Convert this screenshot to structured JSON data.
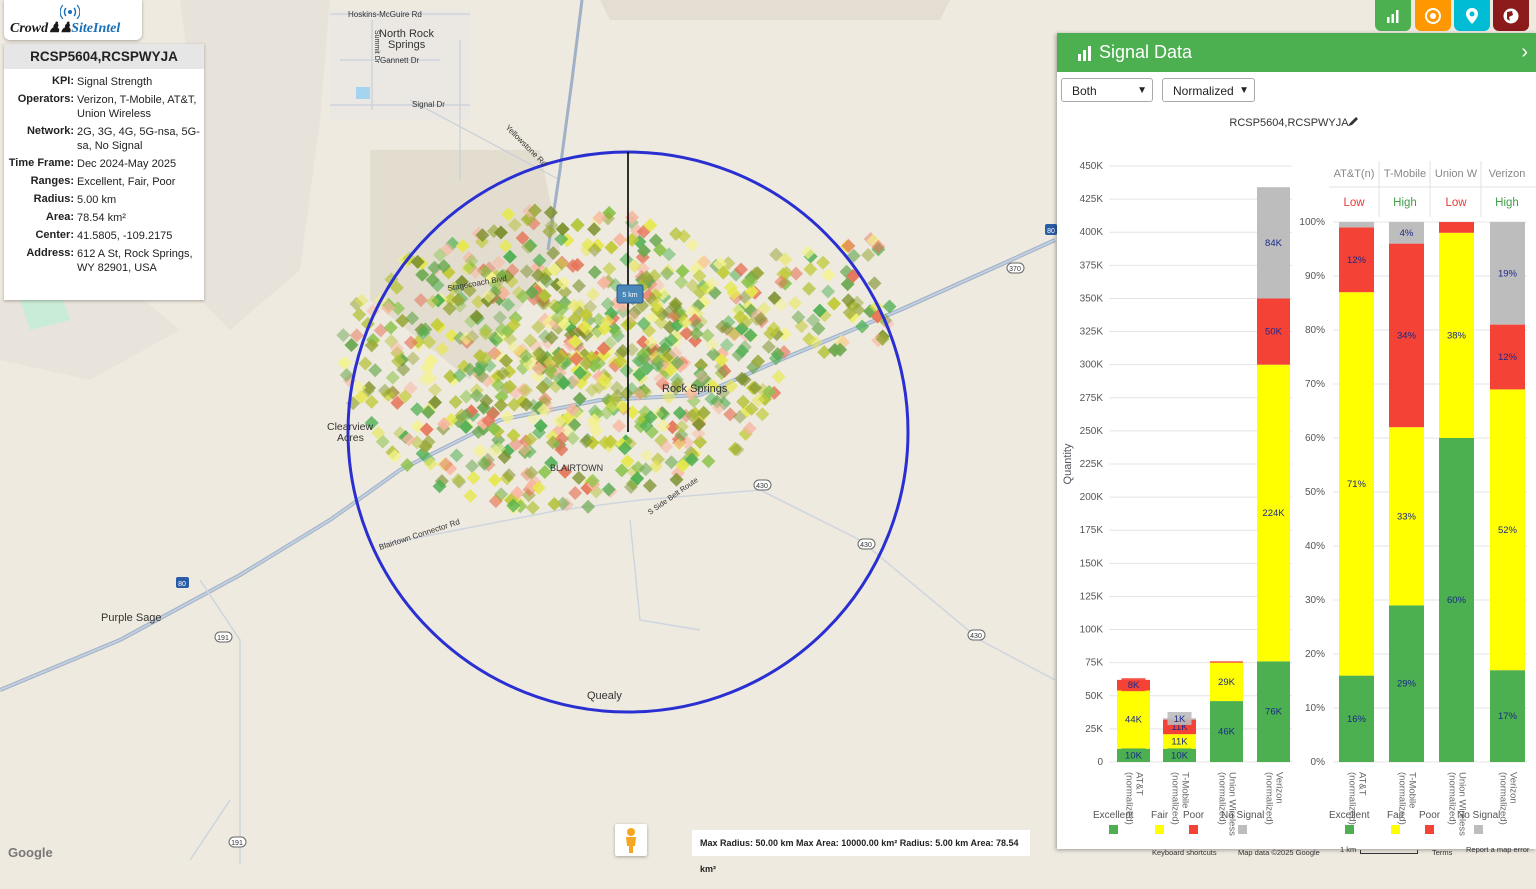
{
  "logo": {
    "part1": "Crowd",
    "part2": "SiteIntel"
  },
  "info": {
    "title": "RCSP5604,RCSPWYJA",
    "rows": [
      {
        "k": "KPI:",
        "v": "Signal Strength"
      },
      {
        "k": "Operators:",
        "v": "Verizon, T-Mobile, AT&T, Union Wireless"
      },
      {
        "k": "Network:",
        "v": "2G, 3G, 4G, 5G-nsa, 5G-sa, No Signal"
      },
      {
        "k": "Time Frame:",
        "v": "Dec 2024-May 2025"
      },
      {
        "k": "Ranges:",
        "v": "Excellent, Fair, Poor"
      },
      {
        "k": "Radius:",
        "v": "5.00 km"
      },
      {
        "k": "Area:",
        "v": "78.54 km²"
      },
      {
        "k": "Center:",
        "v": "41.5805, -109.2175"
      },
      {
        "k": "Address:",
        "v": "612 A St, Rock Springs, WY 82901, USA"
      }
    ]
  },
  "toolbar": {
    "icons": [
      {
        "name": "bar-chart-icon",
        "color": "#4caf50"
      },
      {
        "name": "target-icon",
        "color": "#ff9800"
      },
      {
        "name": "map-pin-icon",
        "color": "#00bcd4"
      },
      {
        "name": "globe-icon",
        "color": "#8b1a1a"
      }
    ]
  },
  "map": {
    "labels": [
      {
        "t": "Hoskins-McGuire Rd"
      },
      {
        "t": "North Rock"
      },
      {
        "t": "Springs"
      },
      {
        "t": "Gannett Dr"
      },
      {
        "t": "Signal Dr"
      },
      {
        "t": "Yellowstone Rd"
      },
      {
        "t": "Summit Dr"
      },
      {
        "t": "Rock Springs"
      },
      {
        "t": "Clearview"
      },
      {
        "t": "Acres"
      },
      {
        "t": "BLAIRTOWN"
      },
      {
        "t": "Blairtown Connector Rd"
      },
      {
        "t": "Purple Sage"
      },
      {
        "t": "Quealy"
      },
      {
        "t": "S Side Belt Route"
      },
      {
        "t": "Stagecoach Blvd"
      }
    ],
    "radius_label": "5 km",
    "shields": [
      "370",
      "430",
      "430",
      "430",
      "191",
      "191",
      "80",
      "80"
    ]
  },
  "panel": {
    "title": "Signal Data",
    "select1": "Both",
    "select2": "Normalized",
    "chart_title": "RCSP5604,RCSPWYJA",
    "col_headers": [
      {
        "name": "AT&T",
        "sup": "(n)",
        "level": "Low",
        "color": "#e53935"
      },
      {
        "name": "T-Mobile",
        "level": "High",
        "color": "#43a047"
      },
      {
        "name": "Union W",
        "level": "Low",
        "color": "#e53935"
      },
      {
        "name": "Verizon",
        "level": "High",
        "color": "#43a047"
      }
    ],
    "legend": [
      {
        "label": "Excellent",
        "color": "#4caf50"
      },
      {
        "label": "Fair",
        "color": "#ffff00"
      },
      {
        "label": "Poor",
        "color": "#f44336"
      },
      {
        "label": "No Signal",
        "color": "#bdbdbd"
      }
    ]
  },
  "chart_data": [
    {
      "type": "bar",
      "stacked": true,
      "title": "",
      "ylabel": "Quantity",
      "ylim": [
        0,
        450000
      ],
      "yticks": [
        "0",
        "25K",
        "50K",
        "75K",
        "100K",
        "125K",
        "150K",
        "175K",
        "200K",
        "225K",
        "250K",
        "275K",
        "300K",
        "325K",
        "350K",
        "375K",
        "400K",
        "425K",
        "450K"
      ],
      "categories": [
        "AT&T (normalized)",
        "T-Mobile (normalized)",
        "Union Wireless (normalized)",
        "Verizon (normalized)"
      ],
      "series": [
        {
          "name": "Excellent",
          "color": "#4caf50",
          "values": [
            10000,
            10000,
            46000,
            76000
          ],
          "labels": [
            "10K",
            "10K",
            "46K",
            "76K"
          ]
        },
        {
          "name": "Fair",
          "color": "#ffff00",
          "values": [
            44000,
            11000,
            29000,
            224000
          ],
          "labels": [
            "44K",
            "11K",
            "29K",
            "224K"
          ]
        },
        {
          "name": "Poor",
          "color": "#f44336",
          "values": [
            8000,
            11000,
            1000,
            50000
          ],
          "labels": [
            "8K",
            "11K",
            "",
            "50K"
          ]
        },
        {
          "name": "No Signal",
          "color": "#bdbdbd",
          "values": [
            0,
            1000,
            0,
            84000
          ],
          "labels": [
            "",
            "1K",
            "",
            "84K"
          ]
        }
      ]
    },
    {
      "type": "bar",
      "stacked": true,
      "title": "",
      "ylim": [
        0,
        100
      ],
      "yticks": [
        "0%",
        "10%",
        "20%",
        "30%",
        "40%",
        "50%",
        "60%",
        "70%",
        "80%",
        "90%",
        "100%"
      ],
      "categories": [
        "AT&T (normalized)",
        "T-Mobile (normalized)",
        "Union Wireless (normalized)",
        "Verizon (normalized)"
      ],
      "series": [
        {
          "name": "Excellent",
          "color": "#4caf50",
          "values": [
            16,
            29,
            60,
            17
          ],
          "labels": [
            "16%",
            "29%",
            "60%",
            "17%"
          ]
        },
        {
          "name": "Fair",
          "color": "#ffff00",
          "values": [
            71,
            33,
            38,
            52
          ],
          "labels": [
            "71%",
            "33%",
            "38%",
            "52%"
          ]
        },
        {
          "name": "Poor",
          "color": "#f44336",
          "values": [
            12,
            34,
            2,
            12
          ],
          "labels": [
            "12%",
            "34%",
            "",
            "12%"
          ]
        },
        {
          "name": "No Signal",
          "color": "#bdbdbd",
          "values": [
            1,
            4,
            0,
            19
          ],
          "labels": [
            "",
            "4%",
            "",
            "19%"
          ]
        }
      ]
    }
  ],
  "footer": {
    "stats": "Max Radius: 50.00 km Max Area: 10000.00 km² Radius: 5.00 km Area: 78.54 km²",
    "keyboard": "Keyboard shortcuts",
    "mapdata": "Map data ©2025 Google",
    "scale": "1 km",
    "terms": "Terms",
    "report": "Report a map error",
    "google": "Google"
  }
}
